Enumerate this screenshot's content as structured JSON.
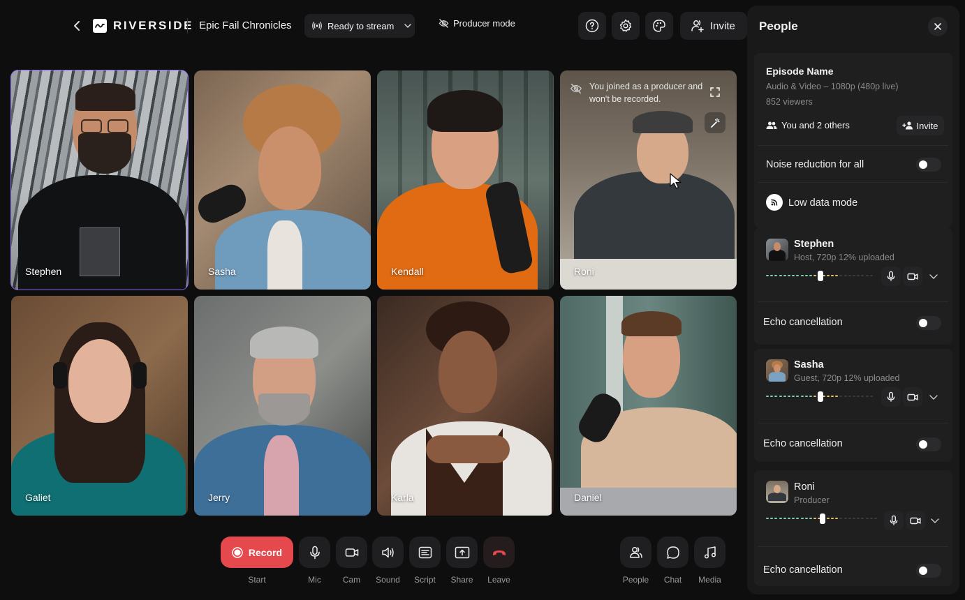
{
  "topbar": {
    "brand": "RIVERSIDE",
    "session_title": "Epic Fail Chronicles",
    "stream_status": "Ready to stream",
    "producer_mode_label": "Producer mode",
    "invite_label": "Invite"
  },
  "grid": {
    "tiles": [
      {
        "name": "Stephen",
        "active": true
      },
      {
        "name": "Sasha",
        "active": false
      },
      {
        "name": "Kendall",
        "active": false
      },
      {
        "name": "Roni",
        "active": false,
        "notice": "You joined as a producer and won't be recorded."
      },
      {
        "name": "Galiet",
        "active": false
      },
      {
        "name": "Jerry",
        "active": false
      },
      {
        "name": "Karla",
        "active": false
      },
      {
        "name": "Daniel",
        "active": false
      }
    ]
  },
  "controls": {
    "record": {
      "label": "Record",
      "caption": "Start"
    },
    "items": [
      {
        "caption": "Mic",
        "icon": "mic-icon"
      },
      {
        "caption": "Cam",
        "icon": "camera-icon"
      },
      {
        "caption": "Sound",
        "icon": "speaker-icon"
      },
      {
        "caption": "Script",
        "icon": "script-icon"
      },
      {
        "caption": "Share",
        "icon": "share-screen-icon"
      },
      {
        "caption": "Leave",
        "icon": "hang-up-icon"
      }
    ],
    "right": [
      {
        "caption": "People",
        "icon": "people-icon"
      },
      {
        "caption": "Chat",
        "icon": "chat-icon"
      },
      {
        "caption": "Media",
        "icon": "music-icon"
      }
    ]
  },
  "panel": {
    "title": "People",
    "episode": {
      "name": "Episode Name",
      "format": "Audio & Video – 1080p (480p live)",
      "viewers": "852 viewers",
      "participants": "You and 2 others",
      "invite_label": "Invite"
    },
    "noise_reduction": {
      "label": "Noise reduction for all",
      "enabled": false
    },
    "low_data_mode": {
      "label": "Low data mode"
    },
    "people": [
      {
        "name": "Stephen",
        "role": "Host, 720p 12% uploaded",
        "volume_percent": 50,
        "echo_label": "Echo cancellation",
        "echo_enabled": false
      },
      {
        "name": "Sasha",
        "role": "Guest, 720p 12% uploaded",
        "volume_percent": 50,
        "echo_label": "Echo cancellation",
        "echo_enabled": false
      },
      {
        "name": "Roni",
        "role": "Producer",
        "volume_percent": 50,
        "echo_label": "Echo cancellation",
        "echo_enabled": false
      }
    ]
  },
  "colors": {
    "accent_purple": "#8e6cf0",
    "record_red": "#e5484d",
    "leave_red": "#e5484d",
    "meter_green": "#7fd1b0",
    "meter_yellow": "#e0c36a"
  }
}
